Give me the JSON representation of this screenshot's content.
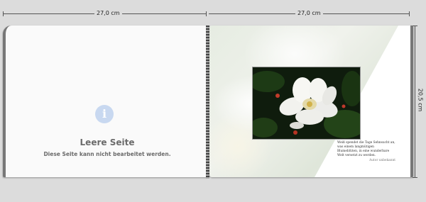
{
  "dimensions": {
    "left_width": "27,0 cm",
    "right_width": "27,0 cm",
    "height": "20,5 cm"
  },
  "left_page": {
    "icon": "info-icon",
    "icon_glyph": "i",
    "title": "Leere Seite",
    "subtitle": "Diese Seite kann nicht bearbeitet werden."
  },
  "right_page": {
    "photo_caption": "Weiß spendet die Tage Sehnsucht an, was einem langmütigen Blumeblüten, in eine wunderbare Welt versetzt zu werden.",
    "photo_signature": "Autor unbekannt"
  },
  "colors": {
    "background": "#dcdcdc",
    "page": "#fafafa",
    "info_icon": "#c8d8f0",
    "text_gray": "#6b6b6b"
  }
}
